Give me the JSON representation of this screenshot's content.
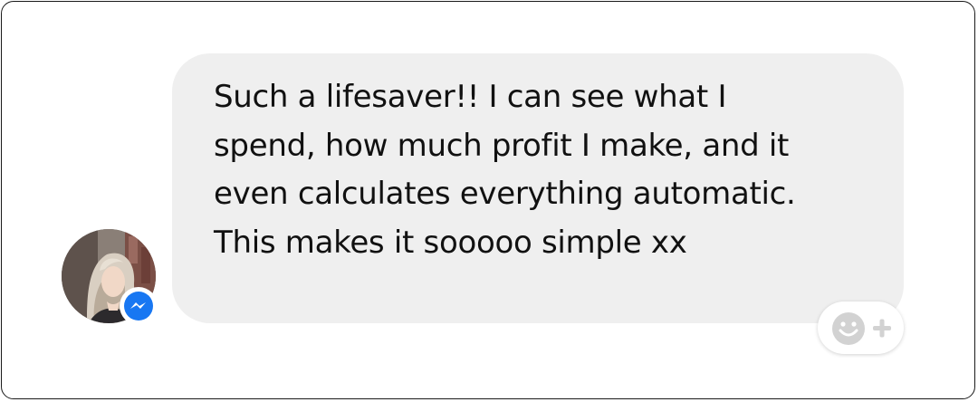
{
  "message": {
    "text": "Such a lifesaver!! I can see what I spend, how much profit I make, and it even calculates everything automatic. This makes it sooooo simple xx"
  },
  "icons": {
    "avatar": "avatar-photo",
    "badge": "messenger-icon",
    "reaction": "add-reaction-icon"
  },
  "colors": {
    "bubble": "#efefef",
    "messenger_blue": "#1877f2",
    "reaction_icon": "#d2d2d2"
  }
}
